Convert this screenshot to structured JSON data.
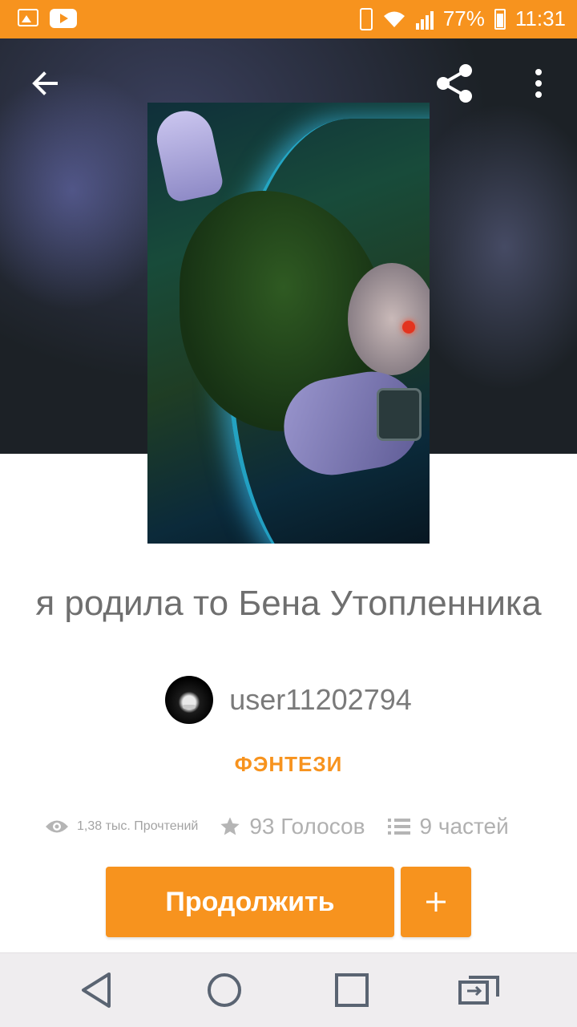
{
  "status_bar": {
    "battery": "77%",
    "time": "11:31"
  },
  "header": {
    "icons": [
      "back-arrow-icon",
      "share-icon",
      "more-vertical-icon"
    ]
  },
  "story": {
    "title": "я родила то Бена Утопленника",
    "author": "user11202794",
    "genre": "ФЭНТЕЗИ",
    "stats": {
      "reads": "1,38 тыс. Прочтений",
      "votes": "93 Голосов",
      "parts": "9 частей"
    }
  },
  "actions": {
    "continue_label": "Продолжить",
    "add_label": "+"
  },
  "colors": {
    "accent": "#f7931e",
    "status_bar": "#f7931e",
    "nav_bar": "#efedef"
  },
  "nav_bar": {
    "icons": [
      "back-triangle-icon",
      "home-circle-icon",
      "recents-square-icon",
      "switch-app-icon"
    ]
  }
}
